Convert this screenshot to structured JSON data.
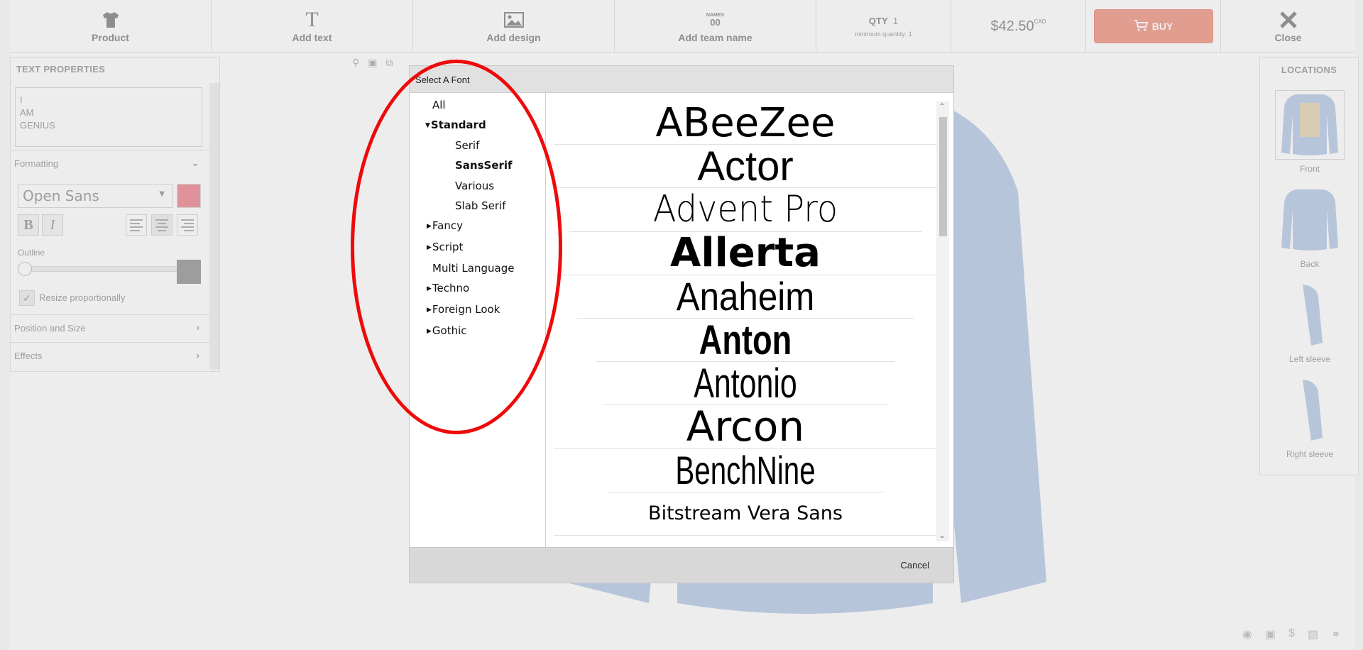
{
  "toolbar": {
    "product_label": "Product",
    "add_text_label": "Add text",
    "add_design_label": "Add design",
    "add_team_name_label": "Add team name",
    "team_icon_text": "NAMES",
    "team_icon_num": "00",
    "qty_label": "QTY",
    "qty_value": "1",
    "qty_min": "minimum quantity: 1",
    "price": "$42.50",
    "currency": "CAD",
    "buy_label": "BUY",
    "close_label": "Close"
  },
  "text_properties": {
    "header": "TEXT PROPERTIES",
    "text_lines": [
      "I",
      "AM",
      "GENIUS"
    ],
    "formatting_label": "Formatting",
    "font_name": "Open Sans",
    "font_color": "#f19ea6",
    "bold_label": "B",
    "italic_label": "I",
    "outline_label": "Outline",
    "outline_color": "#a9a9a9",
    "resize_label": "Resize proportionally",
    "position_label": "Position and Size",
    "effects_label": "Effects"
  },
  "locations": {
    "header": "LOCATIONS",
    "items": [
      "Front",
      "Back",
      "Left sleeve",
      "Right sleeve"
    ]
  },
  "dialog": {
    "title": "Select A Font",
    "categories": {
      "all": "All",
      "standard": "Standard",
      "serif": "Serif",
      "sansserif": "SansSerif",
      "various": "Various",
      "slab_serif": "Slab Serif",
      "fancy": "Fancy",
      "script": "Script",
      "multi_language": "Multi Language",
      "techno": "Techno",
      "foreign_look": "Foreign Look",
      "gothic": "Gothic"
    },
    "fonts": [
      "ABeeZee",
      "Actor",
      "Advent Pro",
      "Allerta",
      "Anaheim",
      "Anton",
      "Antonio",
      "Arcon",
      "BenchNine",
      "Bitstream Vera Sans"
    ],
    "cancel_label": "Cancel"
  },
  "colors": {
    "buy_button": "#f3a99a",
    "annotation": "#ee0a0a",
    "shirt": "#c5d4ec"
  }
}
